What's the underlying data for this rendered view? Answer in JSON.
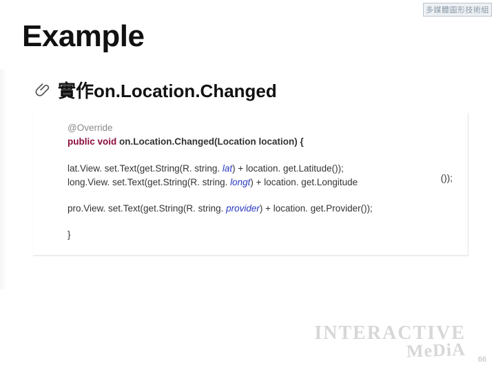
{
  "badge": "多媒體圖形技術組",
  "title": "Example",
  "subheading": "實作on.Location.Changed",
  "code": {
    "l1_anno": "@Override",
    "l2_kw": "public void ",
    "l2_rest": "on.Location.Changed(Location location) {",
    "l4_a": "lat.View. set.Text(get.String(R. string. ",
    "l4_s": "lat",
    "l4_b": ") + location. get.Latitude());",
    "l5_a": "long.View. set.Text(get.String(R. string. ",
    "l5_s": "longt",
    "l5_b": ") + location. get.Longitude",
    "l5_tail": "());",
    "l7_a": "pro.View. set.Text(get.String(R. string. ",
    "l7_s": "provider",
    "l7_b": ") + location. get.Provider());",
    "l9": "}"
  },
  "brand_top": "INTERACTIVE",
  "brand_bot": "MeDiA",
  "page_num": "66"
}
